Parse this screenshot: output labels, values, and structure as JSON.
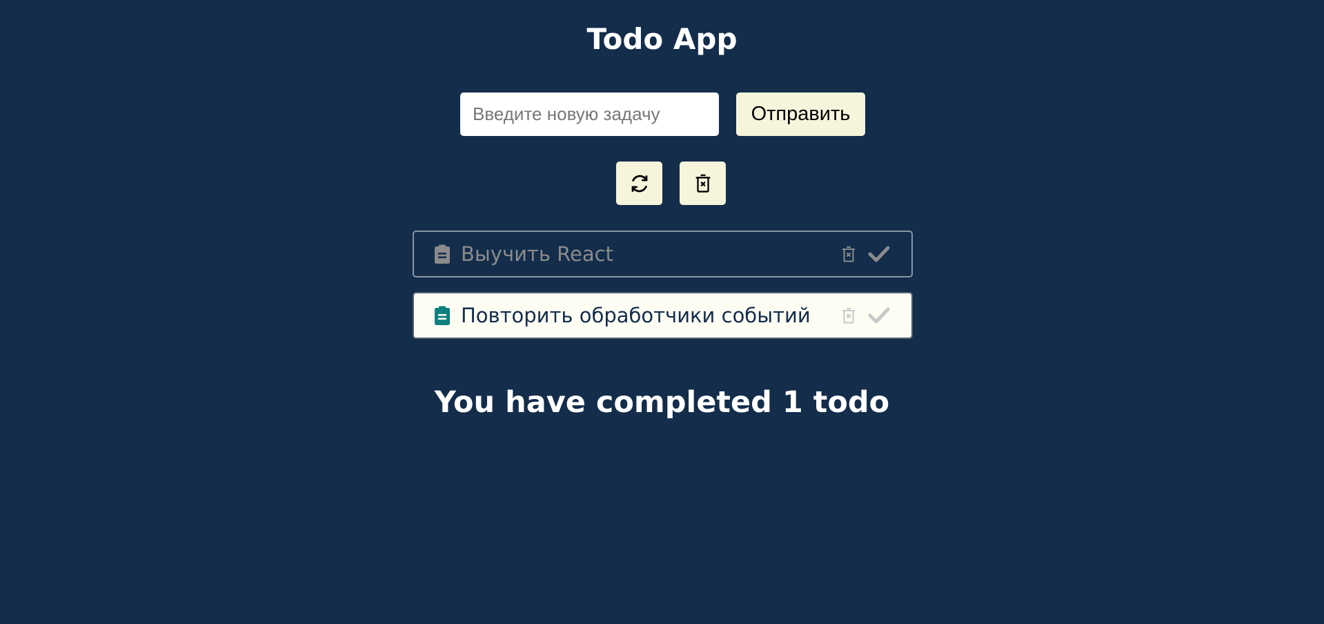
{
  "header": {
    "title": "Todo App"
  },
  "form": {
    "placeholder": "Введите новую задачу",
    "value": "",
    "submit_label": "Отправить"
  },
  "toolbar": {
    "reset_icon": "refresh-icon",
    "clear_icon": "trash-x-icon"
  },
  "todos": [
    {
      "text": "Выучить React",
      "completed": true
    },
    {
      "text": "Повторить обработчики событий",
      "completed": false
    }
  ],
  "summary": {
    "text": "You have completed 1 todo"
  },
  "colors": {
    "background": "#132d4b",
    "button": "#f6f5dc",
    "accent": "#0e7f7f",
    "completed_text": "#8b8b8b",
    "muted_icon": "#c8c8c8"
  }
}
